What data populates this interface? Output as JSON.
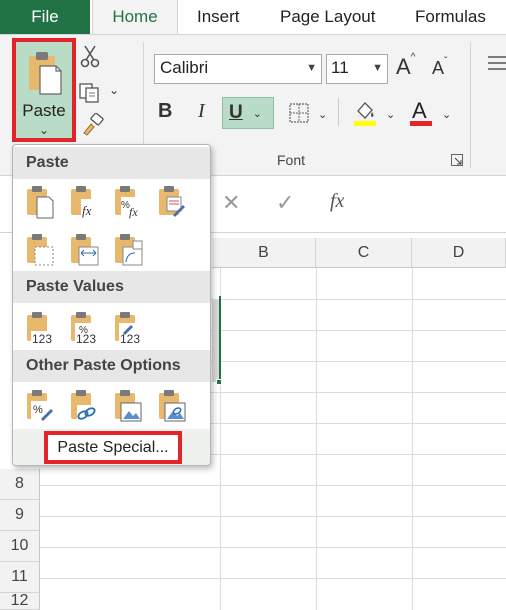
{
  "tabs": {
    "file": "File",
    "home": "Home",
    "insert": "Insert",
    "page_layout": "Page Layout",
    "formulas": "Formulas"
  },
  "clipboard": {
    "paste_label": "Paste",
    "paste_chevron": "⌄"
  },
  "font": {
    "name": "Calibri",
    "size": "11",
    "bold": "B",
    "italic": "I",
    "underline": "U",
    "group_label": "Font",
    "grow": "A",
    "shrink": "A"
  },
  "formula_bar": {
    "cancel": "✕",
    "enter": "✓",
    "function": "fx"
  },
  "grid": {
    "columns": [
      "B",
      "C",
      "D"
    ],
    "rows": [
      "8",
      "9",
      "10",
      "11",
      "12"
    ]
  },
  "paste_menu": {
    "section_paste": "Paste",
    "section_values": "Paste Values",
    "section_other": "Other Paste Options",
    "paste_special": "Paste Special..."
  },
  "colors": {
    "excel_green": "#217346",
    "highlight_red": "#e3242b",
    "paste_button_bg": "#b9dcc6",
    "fill_color": "#ffff00",
    "font_color": "#e3242b"
  }
}
